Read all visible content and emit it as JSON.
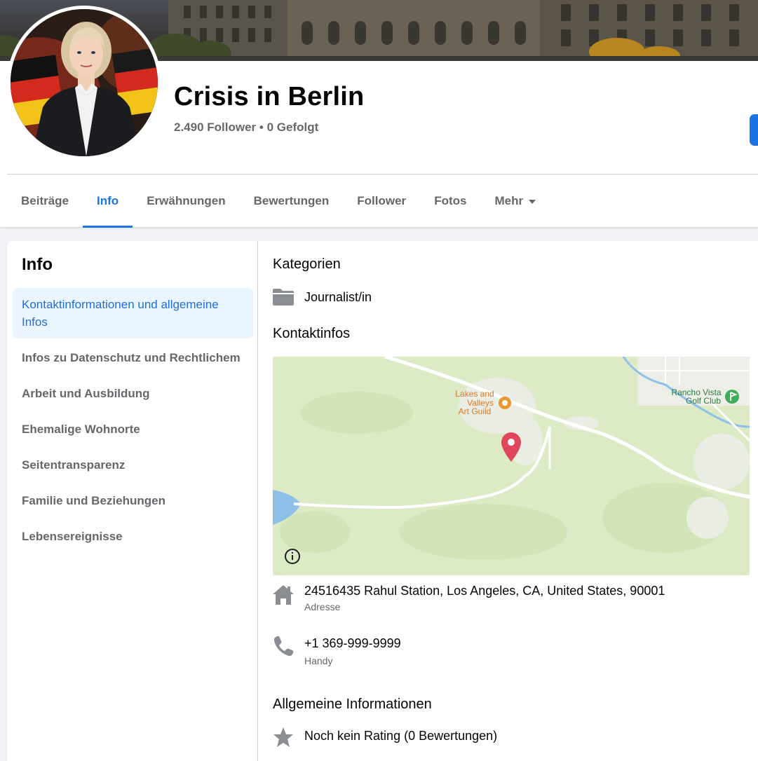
{
  "page": {
    "title": "Crisis in Berlin",
    "followers": "2.490 Follower",
    "separator": "•",
    "following": "0 Gefolgt"
  },
  "tabs": [
    {
      "label": "Beiträge",
      "active": false
    },
    {
      "label": "Info",
      "active": true
    },
    {
      "label": "Erwähnungen",
      "active": false
    },
    {
      "label": "Bewertungen",
      "active": false
    },
    {
      "label": "Follower",
      "active": false
    },
    {
      "label": "Fotos",
      "active": false
    },
    {
      "label": "Mehr",
      "active": false
    }
  ],
  "sidebar": {
    "title": "Info",
    "items": [
      {
        "label": "Kontaktinformationen und allgemeine Infos",
        "active": true
      },
      {
        "label": "Infos zu Datenschutz und Rechtlichem",
        "active": false
      },
      {
        "label": "Arbeit und Ausbildung",
        "active": false
      },
      {
        "label": "Ehemalige Wohnorte",
        "active": false
      },
      {
        "label": "Seitentransparenz",
        "active": false
      },
      {
        "label": "Familie und Beziehungen",
        "active": false
      },
      {
        "label": "Lebensereignisse",
        "active": false
      }
    ]
  },
  "content": {
    "categories_heading": "Kategorien",
    "category": "Journalist/in",
    "contact_heading": "Kontaktinfos",
    "map": {
      "place1_line1": "Lakes and",
      "place1_line2": "Valleys",
      "place1_line3": "Art Guild",
      "place2_line1": "Rancho Vista",
      "place2_line2": "Golf Club",
      "info_icon": "info-icon"
    },
    "address": "24516435 Rahul Station, Los Angeles, CA, United States, 90001",
    "address_label": "Adresse",
    "phone": "+1 369-999-9999",
    "phone_label": "Handy",
    "general_heading": "Allgemeine Informationen",
    "rating": "Noch kein Rating (0 Bewertungen)"
  },
  "colors": {
    "accent": "#1b74e4",
    "text_secondary": "#65676b",
    "icon_gray": "#8a8d91",
    "map_pin": "#e0475e"
  }
}
